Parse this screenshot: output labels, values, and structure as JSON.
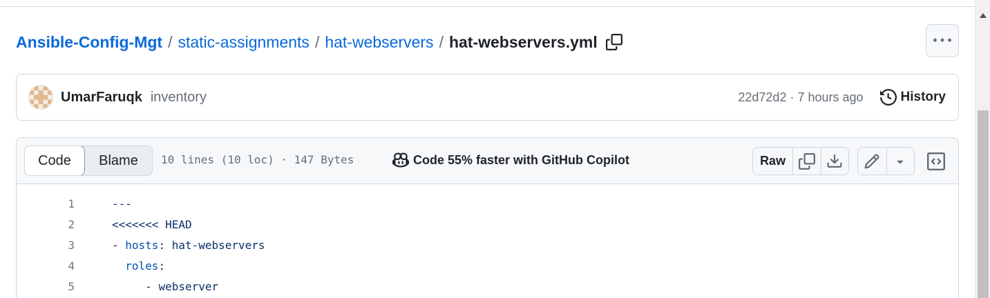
{
  "breadcrumb": {
    "repo": "Ansible-Config-Mgt",
    "separator": "/",
    "dirs": [
      "static-assignments",
      "hat-webservers"
    ],
    "file": "hat-webservers.yml"
  },
  "commit": {
    "author": "UmarFaruqk",
    "message": "inventory",
    "meta": "22d72d2 · 7 hours ago",
    "history_label": "History"
  },
  "file_header": {
    "tabs": [
      "Code",
      "Blame"
    ],
    "active_tab": "Code",
    "info": "10 lines (10 loc) · 147 Bytes",
    "copilot": "Code 55% faster with GitHub Copilot",
    "raw_label": "Raw"
  },
  "code_lines": [
    {
      "num": "1",
      "parts": [
        {
          "t": "---",
          "c": "s"
        }
      ]
    },
    {
      "num": "2",
      "parts": [
        {
          "t": "<<<<<<< HEAD",
          "c": "s"
        }
      ]
    },
    {
      "num": "3",
      "parts": [
        {
          "t": "- ",
          "c": "p"
        },
        {
          "t": "hosts",
          "c": "k"
        },
        {
          "t": ": ",
          "c": "p"
        },
        {
          "t": "hat-webservers",
          "c": "s"
        }
      ]
    },
    {
      "num": "4",
      "parts": [
        {
          "t": "  ",
          "c": "p"
        },
        {
          "t": "roles",
          "c": "k"
        },
        {
          "t": ":",
          "c": "p"
        }
      ]
    },
    {
      "num": "5",
      "parts": [
        {
          "t": "     - ",
          "c": "p"
        },
        {
          "t": "webserver",
          "c": "s"
        }
      ]
    }
  ],
  "icons": {
    "copy_path": "copy-icon",
    "more": "kebab-horizontal-icon",
    "history": "history-icon",
    "copilot": "copilot-icon",
    "copy": "copy-icon",
    "download": "download-icon",
    "edit": "pencil-icon",
    "dropdown": "triangle-down-icon",
    "symbols": "code-square-icon"
  },
  "colors": {
    "link": "#0969da",
    "border": "#d0d7de",
    "muted": "#656d76"
  }
}
